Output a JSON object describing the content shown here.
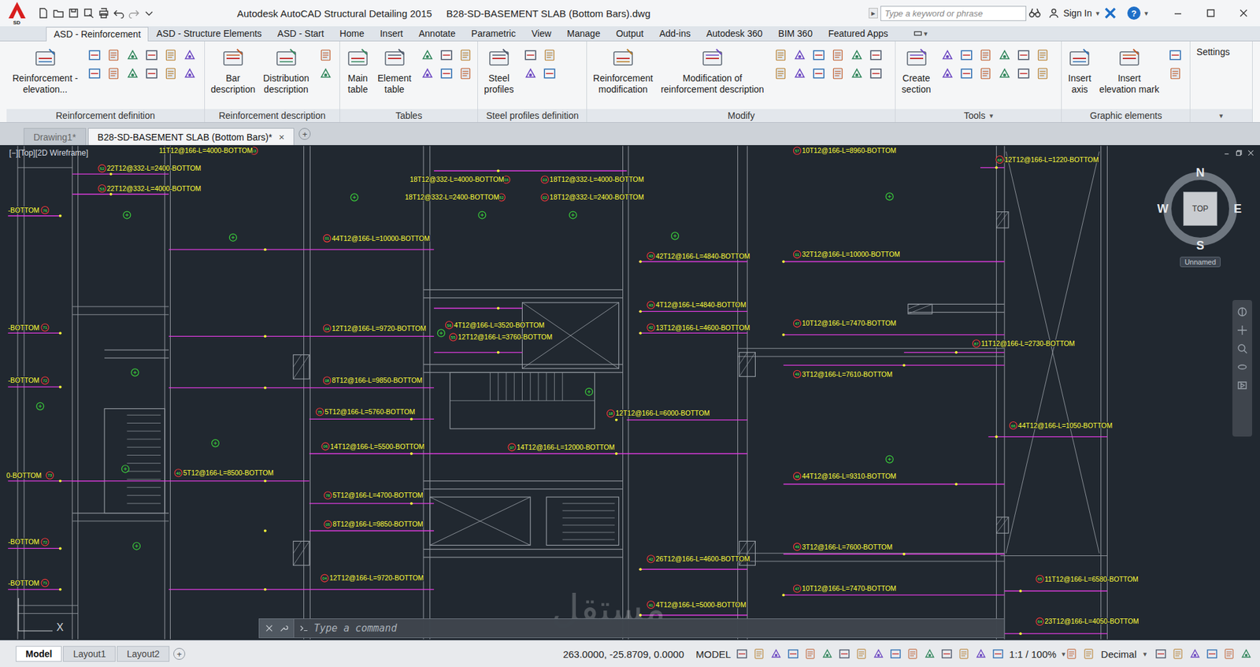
{
  "window": {
    "app_badge": "SD",
    "title": "Autodesk AutoCAD Structural Detailing 2015",
    "file": "B28-SD-BASEMENT SLAB (Bottom Bars).dwg"
  },
  "search": {
    "arrow": "▸",
    "placeholder": "Type a keyword or phrase"
  },
  "account": {
    "label": "Sign In",
    "caret": "▾",
    "help": "?"
  },
  "menu_tabs": [
    {
      "label": "ASD - Reinforcement",
      "selected": true
    },
    {
      "label": "ASD - Structure Elements",
      "selected": false
    },
    {
      "label": "ASD - Start",
      "selected": false
    },
    {
      "label": "Home",
      "selected": false
    },
    {
      "label": "Insert",
      "selected": false
    },
    {
      "label": "Annotate",
      "selected": false
    },
    {
      "label": "Parametric",
      "selected": false
    },
    {
      "label": "View",
      "selected": false
    },
    {
      "label": "Manage",
      "selected": false
    },
    {
      "label": "Output",
      "selected": false
    },
    {
      "label": "Add-ins",
      "selected": false
    },
    {
      "label": "Autodesk 360",
      "selected": false
    },
    {
      "label": "BIM 360",
      "selected": false
    },
    {
      "label": "Featured Apps",
      "selected": false
    }
  ],
  "ribbon_caret": "▾",
  "ribbon_panels": [
    {
      "title": "Reinforcement definition",
      "caret": "",
      "buttons": [
        "Reinforcement -\nelevation..."
      ]
    },
    {
      "title": "Reinforcement description",
      "caret": "",
      "buttons": [
        "Bar\ndescription",
        "Distribution\ndescription"
      ]
    },
    {
      "title": "Tables",
      "caret": "",
      "buttons": [
        "Main\ntable",
        "Element\ntable"
      ]
    },
    {
      "title": "Steel profiles definition",
      "caret": "",
      "buttons": [
        "Steel\nprofiles"
      ]
    },
    {
      "title": "Modify",
      "caret": "",
      "buttons": [
        "Reinforcement\nmodification",
        "Modification of\nreinforcement description"
      ]
    },
    {
      "title": "Tools",
      "caret": "▾",
      "buttons": [
        "Create\nsection"
      ]
    },
    {
      "title": "Graphic elements",
      "caret": "",
      "buttons": [
        "Insert\naxis",
        "Insert\nelevation mark"
      ]
    },
    {
      "title": "",
      "caret": "▾",
      "buttons": [
        "Settings"
      ]
    }
  ],
  "doc_tabs": [
    {
      "label": "Drawing1*",
      "selected": false
    },
    {
      "label": "B28-SD-BASEMENT SLAB (Bottom Bars)*",
      "selected": true
    }
  ],
  "doc_close": "×",
  "doc_new": "+",
  "viewport": {
    "label": "[−][Top][2D Wireframe]",
    "ucs_axis": "X"
  },
  "viewcube": {
    "north": "N",
    "south": "S",
    "east": "E",
    "west": "W",
    "face": "TOP",
    "view": "Unnamed"
  },
  "rebars": [
    {
      "mark": "52",
      "text": "22T12@332-L=2400-BOTTOM",
      "kind": "before"
    },
    {
      "mark": "53",
      "text": "22T12@332-L=4000-BOTTOM",
      "kind": "before"
    },
    {
      "mark": "01",
      "text": "44T12@166-L=10000-BOTTOM",
      "kind": "before"
    },
    {
      "mark": "04",
      "text": "12T12@166-L=9720-BOTTOM",
      "kind": "before"
    },
    {
      "mark": "08",
      "text": "8T12@166-L=9850-BOTTOM",
      "kind": "before"
    },
    {
      "mark": "75",
      "text": "5T12@166-L=5760-BOTTOM",
      "kind": "before"
    },
    {
      "mark": "06",
      "text": "14T12@166-L=5500-BOTTOM",
      "kind": "before"
    },
    {
      "mark": "40",
      "text": "5T12@166-L=8500-BOTTOM",
      "kind": "before"
    },
    {
      "mark": "78",
      "text": "5T12@166-L=4700-BOTTOM",
      "kind": "before"
    },
    {
      "mark": "05",
      "text": "8T12@166-L=9850-BOTTOM",
      "kind": "before"
    },
    {
      "mark": "04",
      "text": "12T12@166-L=9720-BOTTOM",
      "kind": "before"
    },
    {
      "mark": "03",
      "text": "18T12@332-L=4000-BOTTOM",
      "kind": "after"
    },
    {
      "mark": "03",
      "text": "18T12@332-L=4000-BOTTOM",
      "kind": "before"
    },
    {
      "mark": "52",
      "text": "18T12@332-L=2400-BOTTOM",
      "kind": "after"
    },
    {
      "mark": "02",
      "text": "18T12@332-L=2400-BOTTOM",
      "kind": "before"
    },
    {
      "mark": "56",
      "text": "4T12@166-L=3520-BOTTOM",
      "kind": "before"
    },
    {
      "mark": "55",
      "text": "12T12@166-L=3760-BOTTOM",
      "kind": "before"
    },
    {
      "mark": "97",
      "text": "14T12@166-L=12000-BOTTOM",
      "kind": "before"
    },
    {
      "mark": "18",
      "text": "12T12@166-L=6000-BOTTOM",
      "kind": "before"
    },
    {
      "mark": "43",
      "text": "42T12@166-L=4840-BOTTOM",
      "kind": "before"
    },
    {
      "mark": "43",
      "text": "4T12@166-L=4840-BOTTOM",
      "kind": "before"
    },
    {
      "mark": "42",
      "text": "13T12@166-L=4600-BOTTOM",
      "kind": "before"
    },
    {
      "mark": "42",
      "text": "26T12@166-L=4600-BOTTOM",
      "kind": "before"
    },
    {
      "mark": "41",
      "text": "4T12@166-L=5000-BOTTOM",
      "kind": "before"
    },
    {
      "mark": "01",
      "text": "32T12@166-L=10000-BOTTOM",
      "kind": "before"
    },
    {
      "mark": "47",
      "text": "10T12@166-L=7470-BOTTOM",
      "kind": "before"
    },
    {
      "mark": "49",
      "text": "3T12@166-L=7610-BOTTOM",
      "kind": "before"
    },
    {
      "mark": "48",
      "text": "44T12@166-L=9310-BOTTOM",
      "kind": "before"
    },
    {
      "mark": "49",
      "text": "3T12@166-L=7600-BOTTOM",
      "kind": "before"
    },
    {
      "mark": "47",
      "text": "10T12@166-L=7470-BOTTOM",
      "kind": "before"
    },
    {
      "mark": "57",
      "text": "10T12@166-L=8960-BOTTOM",
      "kind": "before"
    },
    {
      "mark": "68",
      "text": "12T12@166-L=1220-BOTTOM",
      "kind": "before"
    },
    {
      "mark": "87",
      "text": "11T12@166-L=2730-BOTTOM",
      "kind": "before"
    },
    {
      "mark": "66",
      "text": "44T12@166-L=1050-BOTTOM",
      "kind": "before"
    },
    {
      "mark": "65",
      "text": "11T12@166-L=6580-BOTTOM",
      "kind": "before"
    },
    {
      "mark": "64",
      "text": "23T12@166-L=4050-BOTTOM",
      "kind": "before"
    },
    {
      "mark": "76",
      "text": "-BOTTOM",
      "kind": "after"
    },
    {
      "mark": "71",
      "text": "-BOTTOM",
      "kind": "after"
    },
    {
      "mark": "72",
      "text": "-BOTTOM",
      "kind": "after"
    },
    {
      "mark": "73",
      "text": "0-BOTTOM",
      "kind": "after"
    },
    {
      "mark": "72",
      "text": "-BOTTOM",
      "kind": "after"
    },
    {
      "mark": "71",
      "text": "-BOTTOM",
      "kind": "after"
    },
    {
      "mark": "53",
      "text": "11T12@166-L=4000-BOTTOM",
      "kind": "after"
    }
  ],
  "command": {
    "placeholder": "Type a command"
  },
  "watermark": {
    "logo": "مستقل"
  },
  "layout_tabs": [
    {
      "label": "Model",
      "selected": true
    },
    {
      "label": "Layout1",
      "selected": false
    },
    {
      "label": "Layout2",
      "selected": false
    }
  ],
  "layout_add": "+",
  "status": {
    "coords": "263.0000, -25.8709, 0.0000",
    "space": "MODEL",
    "scale": "1:1 / 100%",
    "units": "Decimal",
    "caret": "▾"
  }
}
